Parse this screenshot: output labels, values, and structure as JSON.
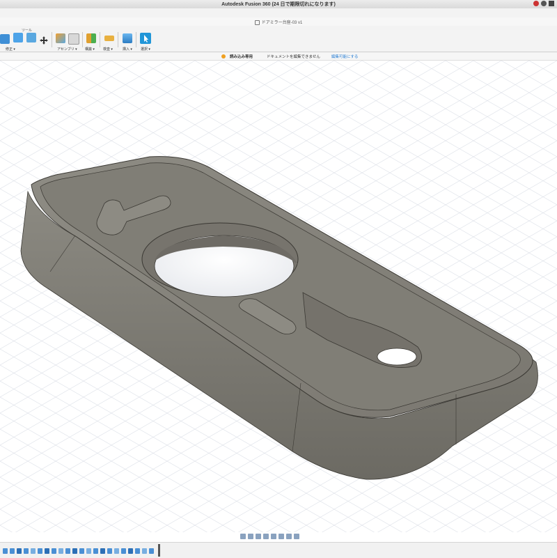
{
  "app": {
    "window_title": "Autodesk Fusion 360 (24 日で期限切れになります)",
    "document_title": "ドアミラー台座-03 v1"
  },
  "toolbar": {
    "tools_caption": "ツール",
    "groups": [
      {
        "label": "修正 ▾"
      },
      {
        "label": "アセンブリ ▾"
      },
      {
        "label": "構築 ▾"
      },
      {
        "label": "検査 ▾"
      },
      {
        "label": "挿入 ▾"
      },
      {
        "label": "選択 ▾"
      }
    ]
  },
  "notice": {
    "status": "読み込み専用",
    "message": "ドキュメントを編集できません",
    "action": "編集可能にする"
  },
  "colors": {
    "model_body": "#7d7a72",
    "model_edge": "#3a3833",
    "grid_line": "#dde1e8",
    "selected_tool": "#2196d8",
    "accent_link": "#2a7fd4"
  },
  "viewport": {
    "model": "object-3d"
  }
}
